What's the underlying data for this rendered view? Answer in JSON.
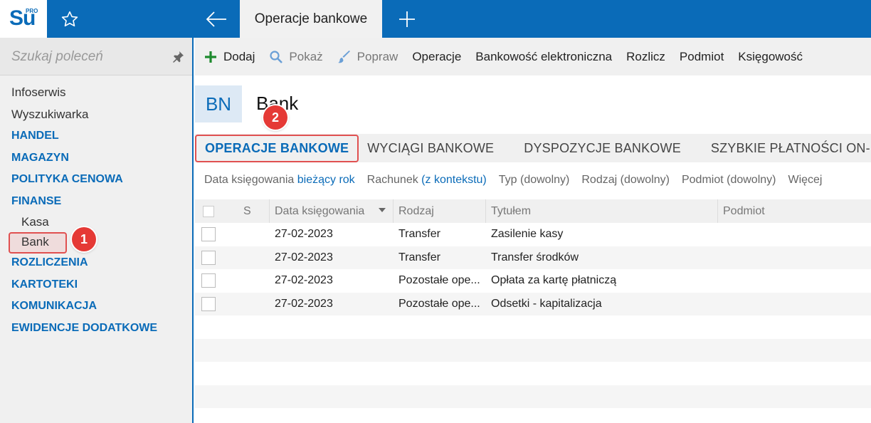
{
  "app": {
    "logo_text": "Su",
    "logo_sup": "PRO",
    "active_tab": "Operacje bankowe"
  },
  "sidebar": {
    "search_placeholder": "Szukaj poleceń",
    "items": [
      {
        "label": "Infoserwis",
        "kind": "plain"
      },
      {
        "label": "Wyszukiwarka",
        "kind": "plain"
      },
      {
        "label": "HANDEL",
        "kind": "section"
      },
      {
        "label": "MAGAZYN",
        "kind": "section"
      },
      {
        "label": "POLITYKA CENOWA",
        "kind": "section"
      },
      {
        "label": "FINANSE",
        "kind": "section"
      },
      {
        "label": "Kasa",
        "kind": "sub"
      },
      {
        "label": "Bank",
        "kind": "sub"
      },
      {
        "label": "ROZLICZENIA",
        "kind": "section"
      },
      {
        "label": "KARTOTEKI",
        "kind": "section"
      },
      {
        "label": "KOMUNIKACJA",
        "kind": "section"
      },
      {
        "label": "EWIDENCJE DODATKOWE",
        "kind": "section"
      }
    ]
  },
  "annotations": {
    "badge1": "1",
    "badge2": "2"
  },
  "toolbar": {
    "dodaj": "Dodaj",
    "pokaz": "Pokaż",
    "popraw": "Popraw",
    "operacje": "Operacje",
    "bankowosc": "Bankowość elektroniczna",
    "rozlicz": "Rozlicz",
    "podmiot": "Podmiot",
    "ksiegowosc": "Księgowość"
  },
  "header": {
    "tile": "BN",
    "title": "Bank"
  },
  "subtabs": [
    "OPERACJE BANKOWE",
    "WYCIĄGI BANKOWE",
    "DYSPOZYCJE BANKOWE",
    "SZYBKIE PŁATNOŚCI ON-LIN"
  ],
  "filters": {
    "data_label": "Data księgowania",
    "data_value": "bieżący rok",
    "rachunek_label": "Rachunek",
    "rachunek_value": "(z kontekstu)",
    "typ": "Typ (dowolny)",
    "rodzaj": "Rodzaj (dowolny)",
    "podmiot": "Podmiot (dowolny)",
    "wiecej": "Więcej"
  },
  "grid": {
    "columns": {
      "s": "S",
      "date": "Data księgowania",
      "rodzaj": "Rodzaj",
      "tytul": "Tytułem",
      "podmiot": "Podmiot"
    },
    "rows": [
      {
        "date": "27-02-2023",
        "rodzaj": "Transfer",
        "tytul": "Zasilenie kasy",
        "podmiot": ""
      },
      {
        "date": "27-02-2023",
        "rodzaj": "Transfer",
        "tytul": "Transfer środków",
        "podmiot": ""
      },
      {
        "date": "27-02-2023",
        "rodzaj": "Pozostałe ope...",
        "tytul": "Opłata za kartę płatniczą",
        "podmiot": ""
      },
      {
        "date": "27-02-2023",
        "rodzaj": "Pozostałe ope...",
        "tytul": "Odsetki - kapitalizacja",
        "podmiot": ""
      }
    ]
  },
  "colors": {
    "brand": "#0a6bb8",
    "annotation": "#e53935"
  }
}
